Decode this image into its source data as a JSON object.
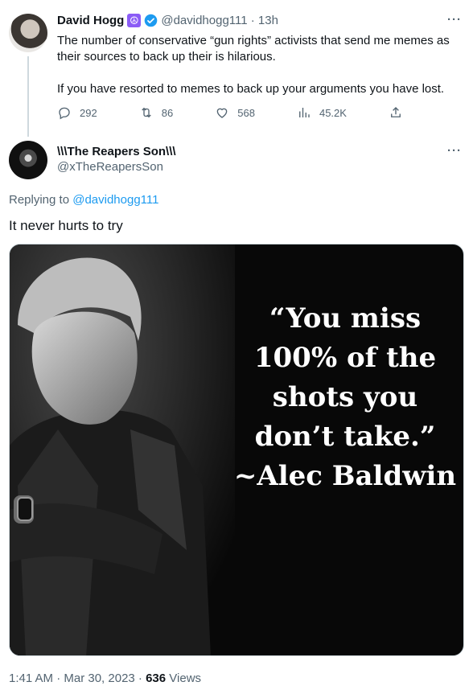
{
  "parent_tweet": {
    "name": "David Hogg",
    "badge_icon": "peace-sign-icon",
    "verified_color": "#1d9bf0",
    "handle_time": "@davidhogg111 · 13h",
    "more": "···",
    "paragraphs": [
      "The number of conservative “gun rights” activists that send me memes as their sources to back up their is hilarious.",
      "If you have resorted to memes to back up your arguments you have lost."
    ],
    "actions": {
      "replies": "292",
      "retweets": "86",
      "likes": "568",
      "views": "45.2K"
    }
  },
  "reply_tweet": {
    "name": "\\\\\\The Reapers Son\\\\\\",
    "handle": "@xTheReapersSon",
    "more": "···",
    "replying_prefix": "Replying to",
    "replying_to": "@davidhogg111",
    "text": "It never hurts to try",
    "meme_quote_lines": [
      "“You miss",
      "100% of the",
      "shots you",
      "don’t take.”",
      "~Alec Baldwin"
    ],
    "time_date": "1:41 AM · Mar 30, 2023 · ",
    "views_count": "636",
    "views_label": " Views"
  },
  "colors": {
    "accent": "#1d9bf0",
    "secondary_text": "#536471",
    "primary_text": "#0f1419"
  }
}
